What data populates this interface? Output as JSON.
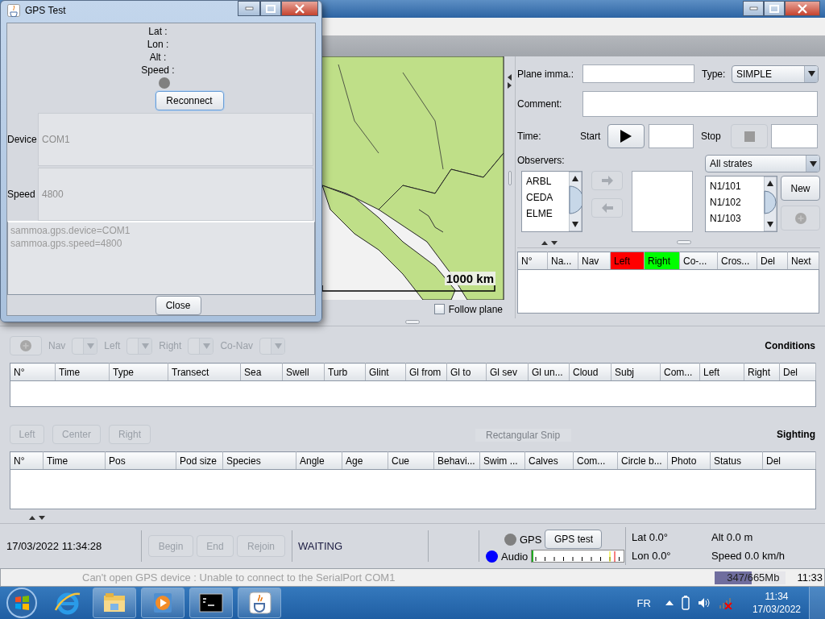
{
  "dialog": {
    "title": "GPS Test",
    "readouts": [
      "Lat :",
      "Lon :",
      "Alt :",
      "Speed :"
    ],
    "status_dot": {
      "color": "#808080"
    },
    "reconnect_button": "Reconnect",
    "fields": [
      {
        "label": "Device",
        "value": "COM1"
      },
      {
        "label": "Speed",
        "value": "4800"
      }
    ],
    "properties": [
      "sammoa.gps.device=COM1",
      "sammoa.gps.speed=4800"
    ],
    "close_button": "Close"
  },
  "map": {
    "scale": "1000 km",
    "follow_plane": {
      "label": "Follow plane",
      "checked": false
    }
  },
  "flight": {
    "plane_label": "Plane imma.:",
    "type_label": "Type:",
    "type_value": "SIMPLE",
    "comment_label": "Comment:",
    "time_label": "Time:",
    "start_label": "Start",
    "start_button": {
      "disabled": false
    },
    "stop_label": "Stop",
    "stop_button": {
      "disabled": true
    },
    "observers_label": "Observers:",
    "observers": [
      "ARBL",
      "CEDA",
      "ELME"
    ],
    "move_buttons": [
      {
        "kind": "right",
        "disabled": true
      },
      {
        "kind": "left",
        "disabled": true
      }
    ],
    "strate_filter": "All strates",
    "strates": [
      "N1/101",
      "N1/102",
      "N1/103"
    ],
    "new_button": {
      "label": "New",
      "disabled": false
    },
    "add_button": {
      "disabled": true
    }
  },
  "transects": {
    "columns": [
      {
        "label": "N°"
      },
      {
        "label": "Na..."
      },
      {
        "label": "Nav"
      },
      {
        "label": "Left",
        "color": "#ff0000"
      },
      {
        "label": "Right",
        "color": "#00ff00"
      },
      {
        "label": "Co-..."
      },
      {
        "label": "Cros..."
      },
      {
        "label": "Del"
      },
      {
        "label": "Next"
      }
    ]
  },
  "conditions": {
    "title": "Conditions",
    "add_button": {
      "disabled": true
    },
    "selectors": [
      {
        "label": "Nav",
        "disabled": true
      },
      {
        "label": "Left",
        "disabled": true
      },
      {
        "label": "Right",
        "disabled": true
      },
      {
        "label": "Co-Nav",
        "disabled": true
      }
    ],
    "columns": [
      "N°",
      "Time",
      "Type",
      "Transect",
      "Sea",
      "Swell",
      "Turb",
      "Glint",
      "Gl from",
      "Gl to",
      "Gl sev",
      "Gl un...",
      "Cloud",
      "Subj",
      "Com...",
      "Left",
      "Right",
      "Del"
    ]
  },
  "sighting": {
    "title": "Sighting",
    "buttons": [
      {
        "label": "Left",
        "disabled": true
      },
      {
        "label": "Center",
        "disabled": true
      },
      {
        "label": "Right",
        "disabled": true
      }
    ],
    "columns": [
      "N°",
      "Time",
      "Pos",
      "Pod size",
      "Species",
      "Angle",
      "Age",
      "Cue",
      "Behavi...",
      "Swim ...",
      "Calves",
      "Com...",
      "Circle b...",
      "Photo",
      "Status",
      "Del"
    ]
  },
  "snip_hint": "Rectangular Snip",
  "status": {
    "datetime": "17/03/2022 11:34:28",
    "buttons": [
      {
        "label": "Begin",
        "disabled": true
      },
      {
        "label": "End",
        "disabled": true
      },
      {
        "label": "Rejoin",
        "disabled": true
      }
    ],
    "state": "WAITING",
    "indicators": [
      {
        "label": "GPS",
        "color": "#808080"
      },
      {
        "label": "Audio",
        "color": "#0000ff"
      }
    ],
    "gps_test_button": "GPS test",
    "lat": "Lat 0.0°",
    "lon": "Lon 0.0°",
    "alt": "Alt 0.0 m",
    "speed": "Speed 0.0 km/h"
  },
  "message_bar": {
    "message": "Can't open GPS device : Unable to connect to the SerialPort COM1",
    "memory": {
      "text": "347/665Mb",
      "level": 0.52
    },
    "clock": "11:33"
  },
  "taskbar": {
    "language": "FR",
    "time": "11:34",
    "date": "17/03/2022"
  }
}
